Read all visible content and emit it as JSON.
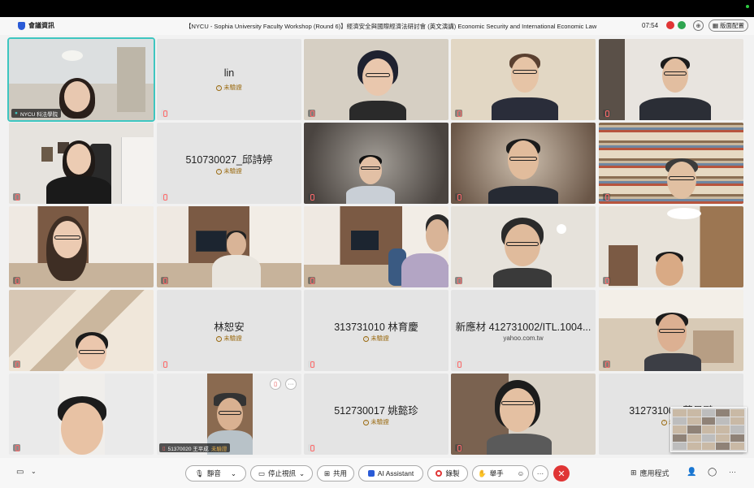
{
  "header": {
    "app_label": "會議資訊",
    "meeting_title": "【NYCU - Sophia University Faculty Workshop (Round 6)】經濟安全與國際經濟法研討會 (英文演講) Economic Security and International Economic Law",
    "time": "07:54",
    "layout_label": "版面配置",
    "zoom_icon": "⊕"
  },
  "tiles": [
    {
      "kind": "video",
      "label": "NYCU 科法學院"
    },
    {
      "kind": "name",
      "name": "lin",
      "status": "未驗證"
    },
    {
      "kind": "video"
    },
    {
      "kind": "video"
    },
    {
      "kind": "video"
    },
    {
      "kind": "video"
    },
    {
      "kind": "name",
      "name": "510730027_邱詩婷",
      "status": "未驗證"
    },
    {
      "kind": "video"
    },
    {
      "kind": "video"
    },
    {
      "kind": "video"
    },
    {
      "kind": "video"
    },
    {
      "kind": "video"
    },
    {
      "kind": "video"
    },
    {
      "kind": "video"
    },
    {
      "kind": "video"
    },
    {
      "kind": "video"
    },
    {
      "kind": "name",
      "name": "林恕安",
      "status": "未驗證"
    },
    {
      "kind": "name",
      "name": "313731010 林育慶",
      "status": "未驗證"
    },
    {
      "kind": "name",
      "name": "新應材 412731002/ITL.1004...",
      "email": "yahoo.com.tw"
    },
    {
      "kind": "video"
    },
    {
      "kind": "video"
    },
    {
      "kind": "video",
      "label": "51370020 王平成",
      "label_status": "未驗證"
    },
    {
      "kind": "name",
      "name": "512730017 姚懿珍",
      "status": "未驗證"
    },
    {
      "kind": "video"
    },
    {
      "kind": "name",
      "name": "312731004 莫易鵬",
      "status": "未驗"
    }
  ],
  "toolbar": {
    "mute_label": "靜音",
    "stop_video_label": "停止視訊",
    "share_label": "共用",
    "ai_label": "AI Assistant",
    "record_label": "錄製",
    "raise_hand_label": "舉手",
    "apps_label": "應用程式",
    "more_icon": "···",
    "end_icon": "✕",
    "emoji_icon": "☺"
  }
}
